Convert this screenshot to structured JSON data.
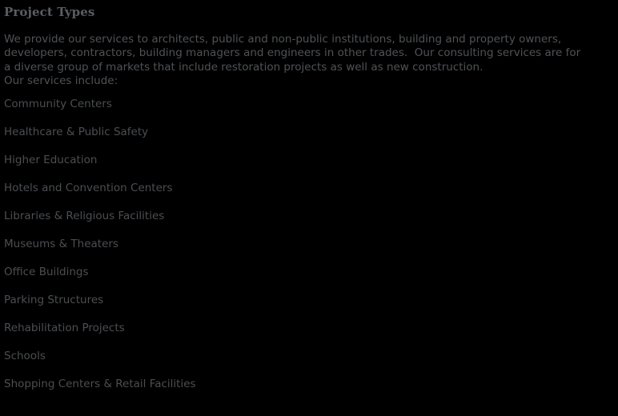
{
  "document": {
    "heading": "Project Types",
    "background_color": "#000000",
    "heading_color": "#5a5d61",
    "body_color": "#4f5256",
    "list_color": "#4b4e52"
  },
  "intro": {
    "lines": [
      "We provide our services to architects, public and non-public institutions, building and property owners,",
      "developers, contractors, building managers and engineers in other trades.  Our consulting services are for",
      "a diverse group of markets that include restoration projects as well as new construction.",
      "Our services include:"
    ]
  },
  "services": {
    "items": [
      {
        "label": "Community Centers"
      },
      {
        "label": "Healthcare & Public Safety"
      },
      {
        "label": "Higher Education"
      },
      {
        "label": "Hotels and Convention Centers"
      },
      {
        "label": "Libraries & Religious Facilities"
      },
      {
        "label": "Museums & Theaters"
      },
      {
        "label": "Office Buildings"
      },
      {
        "label": "Parking Structures"
      },
      {
        "label": "Rehabilitation Projects"
      },
      {
        "label": "Schools"
      },
      {
        "label": "Shopping Centers & Retail Facilities"
      }
    ]
  }
}
